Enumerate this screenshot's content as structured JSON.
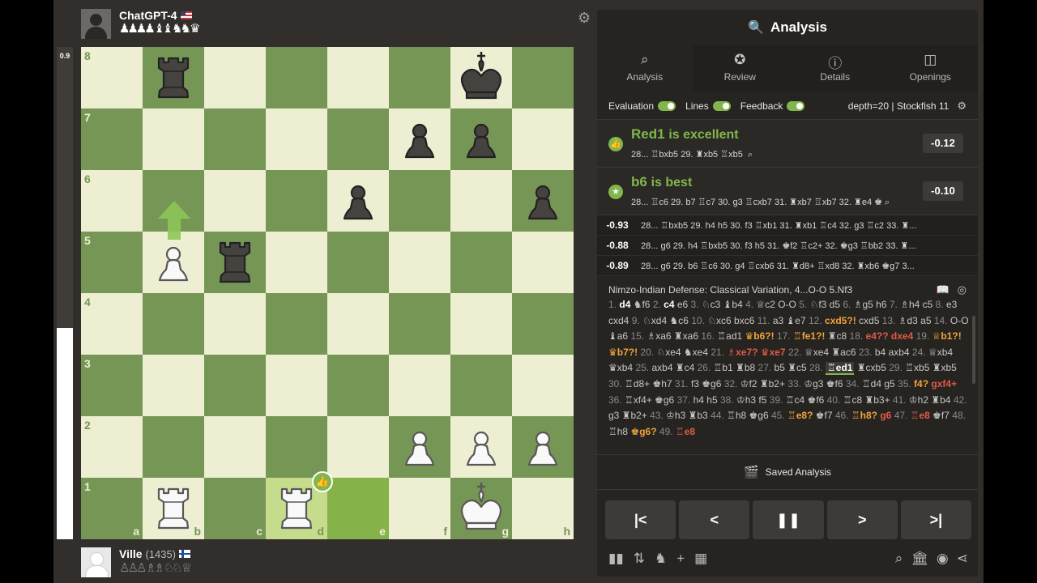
{
  "top_player": {
    "name": "ChatGPT-4",
    "captured": "♟♟♟♟ ♝♝ ♞♞ ♛"
  },
  "bottom_player": {
    "name": "Ville",
    "rating": "(1435)",
    "captured": "♙♙♙ ♗♗ ♘♘ ♕"
  },
  "eval_bar": {
    "score": "0.9",
    "white_fraction": 0.43
  },
  "board": {
    "ranks": [
      "8",
      "7",
      "6",
      "5",
      "4",
      "3",
      "2",
      "1"
    ],
    "files": [
      "a",
      "b",
      "c",
      "d",
      "e",
      "f",
      "g",
      "h"
    ],
    "pieces": [
      {
        "sq": "b8",
        "p": "r",
        "color": "b"
      },
      {
        "sq": "g8",
        "p": "k",
        "color": "b"
      },
      {
        "sq": "f7",
        "p": "p",
        "color": "b"
      },
      {
        "sq": "g7",
        "p": "p",
        "color": "b"
      },
      {
        "sq": "e6",
        "p": "p",
        "color": "b"
      },
      {
        "sq": "h6",
        "p": "p",
        "color": "b"
      },
      {
        "sq": "b5",
        "p": "p",
        "color": "w"
      },
      {
        "sq": "c5",
        "p": "r",
        "color": "b"
      },
      {
        "sq": "f2",
        "p": "p",
        "color": "w"
      },
      {
        "sq": "g2",
        "p": "p",
        "color": "w"
      },
      {
        "sq": "h2",
        "p": "p",
        "color": "w"
      },
      {
        "sq": "b1",
        "p": "r",
        "color": "w"
      },
      {
        "sq": "d1",
        "p": "r",
        "color": "w"
      },
      {
        "sq": "g1",
        "p": "k",
        "color": "w"
      }
    ],
    "highlight": [
      "d1",
      "e1"
    ]
  },
  "panel": {
    "title": "Analysis",
    "tabs": [
      {
        "label": "Analysis",
        "icon": "🔍"
      },
      {
        "label": "Review",
        "icon": "★"
      },
      {
        "label": "Details",
        "icon": "ℹ"
      },
      {
        "label": "Openings",
        "icon": "▦"
      }
    ],
    "toggles": {
      "evaluation": "Evaluation",
      "lines": "Lines",
      "feedback": "Feedback",
      "engine": "depth=20 | Stockfish 11"
    },
    "played": {
      "move": "Red1",
      "quality": "is excellent",
      "line": "28... ♖bxb5 29. ♜xb5 ♖xb5 ",
      "score": "-0.12"
    },
    "best": {
      "move": "b6",
      "quality": "is best",
      "line": "28... ♖c6 29. b7 ♖c7 30. g3 ♖cxb7 31. ♜xb7 ♖xb7 32. ♜e4 ♚",
      "score": "-0.10"
    },
    "engine_lines": [
      {
        "ev": "-0.93",
        "line": "28... ♖bxb5 29. h4 h5 30. f3 ♖xb1 31. ♜xb1 ♖c4 32. g3 ♖c2 33. ♜..."
      },
      {
        "ev": "-0.88",
        "line": "28... g6 29. h4 ♖bxb5 30. f3 h5 31. ♚f2 ♖c2+ 32. ♚g3 ♖bb2 33. ♜..."
      },
      {
        "ev": "-0.89",
        "line": "28... g6 29. b6 ♖c6 30. g4 ♖cxb6 31. ♜d8+ ♖xd8 32. ♜xb6 ♚g7 3..."
      }
    ],
    "opening": "Nimzo-Indian Defense: Classical Variation, 4...O-O 5.Nf3",
    "saved": "Saved Analysis"
  }
}
